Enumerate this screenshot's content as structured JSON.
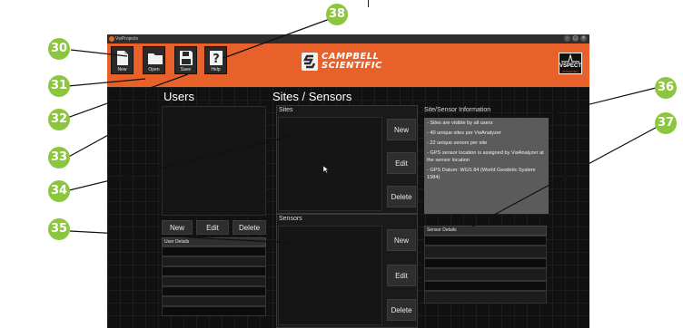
{
  "window": {
    "title": "VwProjects",
    "controls": [
      "–",
      "□",
      "×"
    ]
  },
  "toolbar": {
    "items": [
      {
        "label": "New",
        "icon": "new-document-icon"
      },
      {
        "label": "Open",
        "icon": "folder-icon"
      },
      {
        "label": "Save",
        "icon": "floppy-disk-icon"
      },
      {
        "label": "Help",
        "icon": "question-mark-icon"
      }
    ]
  },
  "brand": {
    "line1": "CAMPBELL",
    "line2": "SCIENTIFIC",
    "badge_name": "VSPECT",
    "badge_sub": "POWERED"
  },
  "users": {
    "heading": "Users",
    "buttons": {
      "new": "New",
      "edit": "Edit",
      "delete": "Delete"
    },
    "details_header": "User Details"
  },
  "sites_sensors": {
    "heading": "Sites / Sensors",
    "sites_label": "Sites",
    "sensors_label": "Sensors",
    "site_buttons": {
      "new": "New",
      "edit": "Edit",
      "delete": "Delete"
    },
    "sensor_buttons": {
      "new": "New",
      "edit": "Edit",
      "delete": "Delete"
    }
  },
  "info": {
    "heading": "Site/Sensor Information",
    "lines": [
      "- Sites are visible by all users",
      "- 40 unique sites per VwAnalyzer",
      "- 22 unique senors per site",
      "- GPS sensor location is assigned by VwAnalyzer at the sensor location",
      "- GPS Datum: WGS 84 (World Geodetic System 1984)"
    ],
    "sensor_details_header": "Sensor Details"
  },
  "callouts": [
    "30",
    "31",
    "32",
    "33",
    "34",
    "35",
    "36",
    "37",
    "38"
  ],
  "colors": {
    "accent_orange": "#e8612a",
    "callout_green": "#8cc63e",
    "background_dark": "#111111"
  }
}
